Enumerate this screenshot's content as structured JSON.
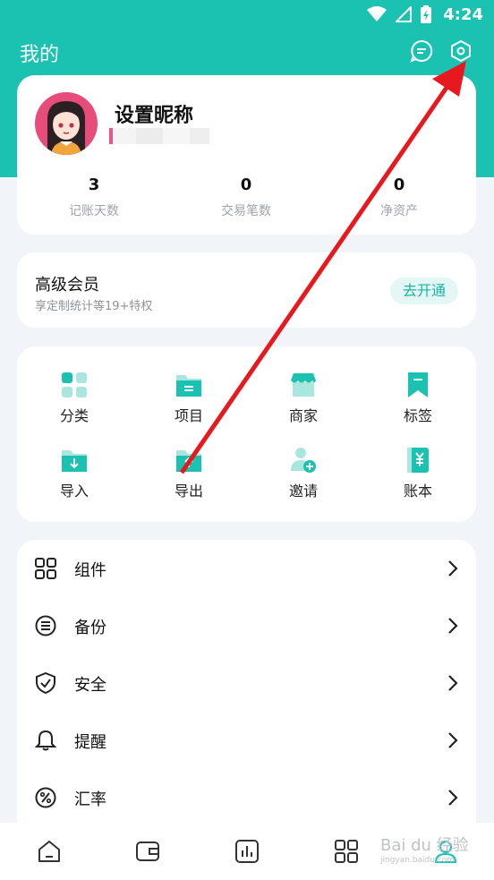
{
  "status": {
    "time": "4:24"
  },
  "header": {
    "title": "我的"
  },
  "profile": {
    "nickname": "设置昵称",
    "stats": [
      {
        "value": "3",
        "label": "记账天数"
      },
      {
        "value": "0",
        "label": "交易笔数"
      },
      {
        "value": "0",
        "label": "净资产"
      }
    ]
  },
  "vip": {
    "title": "高级会员",
    "subtitle": "享定制统计等19+特权",
    "button": "去开通"
  },
  "grid": [
    {
      "label": "分类",
      "icon": "category-icon"
    },
    {
      "label": "项目",
      "icon": "project-folder-icon"
    },
    {
      "label": "商家",
      "icon": "store-icon"
    },
    {
      "label": "标签",
      "icon": "bookmark-tag-icon"
    },
    {
      "label": "导入",
      "icon": "import-folder-icon"
    },
    {
      "label": "导出",
      "icon": "export-folder-icon"
    },
    {
      "label": "邀请",
      "icon": "invite-user-icon"
    },
    {
      "label": "账本",
      "icon": "ledger-book-icon"
    }
  ],
  "menu": [
    {
      "label": "组件",
      "icon": "widget-grid-icon"
    },
    {
      "label": "备份",
      "icon": "backup-icon"
    },
    {
      "label": "安全",
      "icon": "shield-check-icon"
    },
    {
      "label": "提醒",
      "icon": "bell-icon"
    },
    {
      "label": "汇率",
      "icon": "percent-icon"
    }
  ],
  "tabs": [
    "home-icon",
    "wallet-icon",
    "chart-icon",
    "apps-icon",
    "profile-icon"
  ],
  "watermark": {
    "text": "Bai du 经验",
    "sub": "jingyan.baidu.com"
  },
  "colors": {
    "accent": "#1cc2b1",
    "annotation": "#e8191e"
  }
}
